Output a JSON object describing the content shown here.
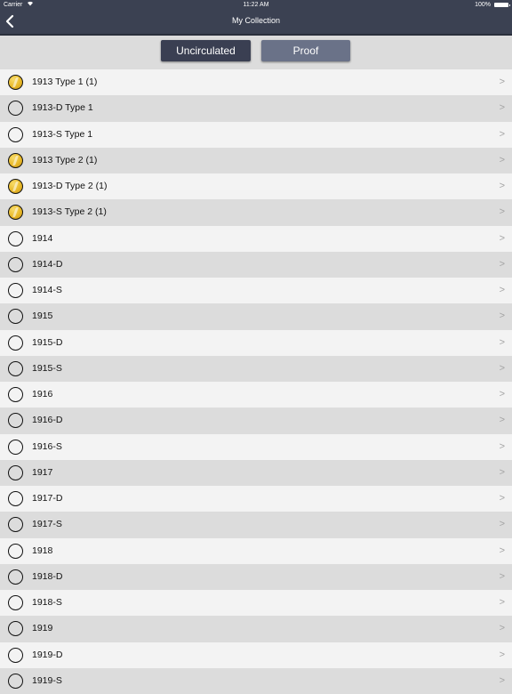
{
  "status_bar": {
    "carrier": "Carrier",
    "time": "11:22 AM",
    "battery": "100%"
  },
  "nav": {
    "title": "My Collection",
    "back_icon": "chevron-left-icon"
  },
  "segments": {
    "uncirculated": "Uncirculated",
    "proof": "Proof",
    "selected": "Uncirculated"
  },
  "colors": {
    "nav_bar": "#3b4152",
    "segment_selected": "#3a3f52",
    "segment_unselected": "#6a7288",
    "coin_gold": "#e9b928"
  },
  "coins": [
    {
      "label": "1913 Type 1 (1)",
      "owned": true
    },
    {
      "label": "1913-D Type 1",
      "owned": false
    },
    {
      "label": "1913-S Type 1",
      "owned": false
    },
    {
      "label": "1913 Type 2 (1)",
      "owned": true
    },
    {
      "label": "1913-D Type 2 (1)",
      "owned": true
    },
    {
      "label": "1913-S Type 2 (1)",
      "owned": true
    },
    {
      "label": "1914",
      "owned": false
    },
    {
      "label": "1914-D",
      "owned": false
    },
    {
      "label": "1914-S",
      "owned": false
    },
    {
      "label": "1915",
      "owned": false
    },
    {
      "label": "1915-D",
      "owned": false
    },
    {
      "label": "1915-S",
      "owned": false
    },
    {
      "label": "1916",
      "owned": false
    },
    {
      "label": "1916-D",
      "owned": false
    },
    {
      "label": "1916-S",
      "owned": false
    },
    {
      "label": "1917",
      "owned": false
    },
    {
      "label": "1917-D",
      "owned": false
    },
    {
      "label": "1917-S",
      "owned": false
    },
    {
      "label": "1918",
      "owned": false
    },
    {
      "label": "1918-D",
      "owned": false
    },
    {
      "label": "1918-S",
      "owned": false
    },
    {
      "label": "1919",
      "owned": false
    },
    {
      "label": "1919-D",
      "owned": false
    },
    {
      "label": "1919-S",
      "owned": false
    }
  ],
  "chevron_glyph": ">"
}
